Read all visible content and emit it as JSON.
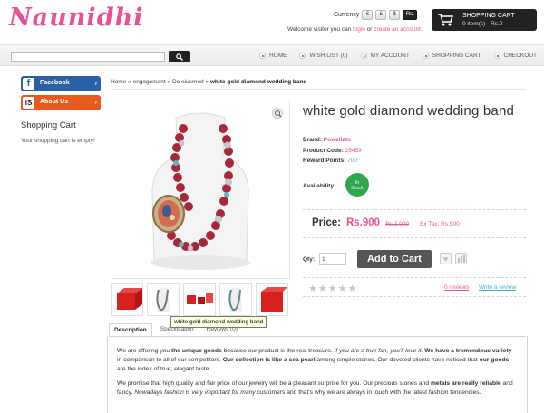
{
  "header": {
    "logo": "Naunidhi",
    "currency_label": "Currency",
    "currencies": [
      "€",
      "£",
      "$",
      "Rs."
    ],
    "welcome_prefix": "Welcome visitor you can",
    "login": "login",
    "or": "or",
    "create_account": "create an account.",
    "cart_title": "SHOPPING CART",
    "cart_items": "0 item(s) - Rs.0"
  },
  "nav": {
    "items": [
      "HOME",
      "WISH LIST (0)",
      "MY ACCOUNT",
      "SHOPPING CART",
      "CHECKOUT"
    ]
  },
  "sidebar": {
    "facebook": "Facebook",
    "about_us": "About Us",
    "cart_title": "Shopping Cart",
    "cart_empty": "Your shopping cart is empty!"
  },
  "breadcrumb": {
    "home": "Home",
    "cat1": "engagement",
    "cat2": "Do eiusmod",
    "current": "white gold diamond wedding band"
  },
  "product": {
    "title": "white gold diamond wedding band",
    "brand_label": "Brand:",
    "brand": "Powellato",
    "code_label": "Product Code:",
    "code": "25459",
    "points_label": "Reward Points:",
    "points": "700",
    "availability_label": "Availability:",
    "stock_line1": "In",
    "stock_line2": "Stock",
    "price_label": "Price:",
    "price_new": "Rs.900",
    "price_old": "Rs.1,000",
    "price_tax": "Ex Tax: Rs.900",
    "qty_label": "Qty:",
    "qty_value": "1",
    "add_to_cart": "Add to Cart",
    "stars": "★★★★★",
    "reviews_link": "0 reviews",
    "write_review": "Write a review",
    "tooltip": "white gold diamond wedding band"
  },
  "tabs": [
    "Description",
    "Specification",
    "Reviews (0)"
  ],
  "description": {
    "p1": [
      {
        "t": "We are offering you ",
        "s": ""
      },
      {
        "t": "the unique goods",
        "s": "b"
      },
      {
        "t": " because our product is the real treasure. ",
        "s": ""
      },
      {
        "t": "If you are a true fan, you'll love it.",
        "s": "i"
      },
      {
        "t": " We have a tremendous variety",
        "s": "b"
      },
      {
        "t": " in comparison to all of our competitors. ",
        "s": ""
      },
      {
        "t": "Our collection is like a sea pearl",
        "s": "b"
      },
      {
        "t": " among simple stones. Our devoted clients have noticed that ",
        "s": ""
      },
      {
        "t": "our goods",
        "s": "b"
      },
      {
        "t": " are the index of true, elegant taste.",
        "s": ""
      }
    ],
    "p2": [
      {
        "t": "We promise that high quality and fair price of our jewelry will be a pleasant surprise for you. Our precious stones and ",
        "s": ""
      },
      {
        "t": "metals are really reliable",
        "s": "b"
      },
      {
        "t": " and fancy. ",
        "s": ""
      },
      {
        "t": "Nowadays fashion is very important for many",
        "s": "i"
      },
      {
        "t": " customers and that's why we are always in touch with the latest fashion tendencies.",
        "s": ""
      }
    ]
  },
  "colors": {
    "accent_pink": "#ec4f95",
    "teal": "#3bb3c3",
    "stock_green": "#2ea84a",
    "facebook_blue": "#2b5fa6",
    "linkedin_orange": "#e85a1e"
  }
}
